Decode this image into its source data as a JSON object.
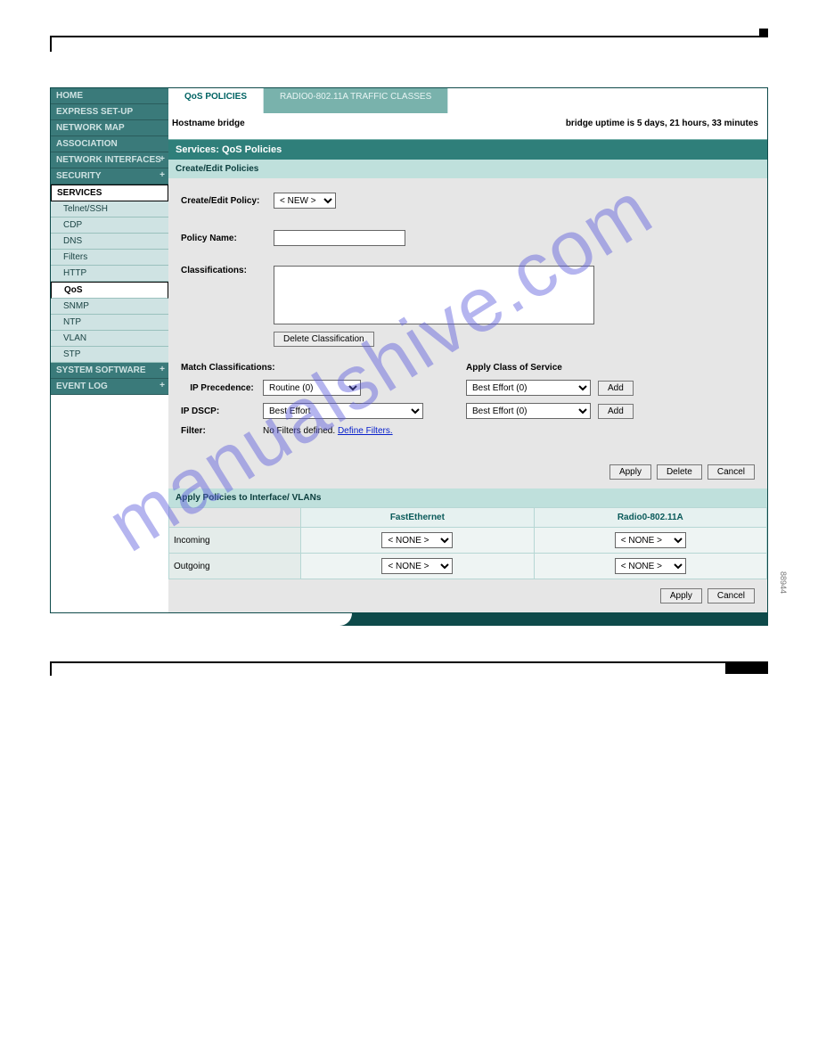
{
  "watermark": "manualshive.com",
  "figure_id": "88944",
  "nav": {
    "home": "HOME",
    "express": "EXPRESS SET-UP",
    "netmap": "NETWORK MAP",
    "association": "ASSOCIATION",
    "netif": "NETWORK INTERFACES",
    "security": "SECURITY",
    "services": "SERVICES",
    "sysw": "SYSTEM SOFTWARE",
    "evlog": "EVENT LOG",
    "sub": {
      "telnet": "Telnet/SSH",
      "cdp": "CDP",
      "dns": "DNS",
      "filters": "Filters",
      "http": "HTTP",
      "qos": "QoS",
      "snmp": "SNMP",
      "ntp": "NTP",
      "vlan": "VLAN",
      "stp": "STP"
    }
  },
  "tabs": [
    "QoS POLICIES",
    "RADIO0-802.11A TRAFFIC CLASSES"
  ],
  "host": {
    "left": "Hostname bridge",
    "right": "bridge uptime is 5 days, 21 hours, 33 minutes"
  },
  "sections": {
    "title": "Services: QoS Policies",
    "create_edit": "Create/Edit Policies",
    "apply_vlan": "Apply Policies to Interface/ VLANs"
  },
  "form": {
    "create_edit_policy": "Create/Edit Policy:",
    "policy_select": "< NEW >",
    "policy_name_lbl": "Policy Name:",
    "policy_name_val": "",
    "classifications_lbl": "Classifications:",
    "match_class_lbl": "Match Classifications:",
    "apply_cos_lbl": "Apply Class of Service",
    "ip_prec_lbl": "IP Precedence:",
    "ip_prec_val": "Routine (0)",
    "ip_dscp_lbl": "IP DSCP:",
    "ip_dscp_val": "Best Effort",
    "filter_lbl": "Filter:",
    "filter_txt": "No Filters defined.",
    "filter_link": "Define Filters.",
    "cos1": "Best Effort (0)",
    "cos2": "Best Effort (0)"
  },
  "buttons": {
    "delete_class": "Delete Classification",
    "add": "Add",
    "apply": "Apply",
    "delete": "Delete",
    "cancel": "Cancel"
  },
  "iface": {
    "cols": [
      "FastEthernet",
      "Radio0-802.11A"
    ],
    "rows": [
      "Incoming",
      "Outgoing"
    ],
    "none": "< NONE >"
  }
}
